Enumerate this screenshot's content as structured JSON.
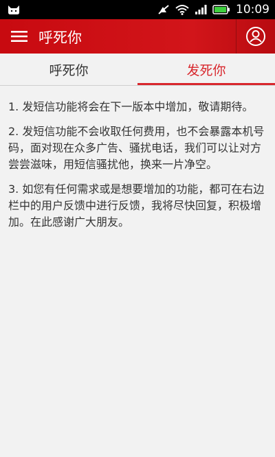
{
  "status_bar": {
    "time": "10:09",
    "icons": [
      "cat-icon",
      "mute-icon",
      "wifi-icon",
      "signal-icon",
      "battery-icon"
    ]
  },
  "app_bar": {
    "title": "呼死你",
    "menu_icon": "hamburger-icon",
    "user_icon": "user-circle-icon"
  },
  "tabs": [
    {
      "label": "呼死你",
      "selected": false
    },
    {
      "label": "发死你",
      "selected": true
    }
  ],
  "notice": [
    "1. 发短信功能将会在下一版本中增加，敬请期待。",
    "2. 发短信功能不会收取任何费用，也不会暴露本机号码，面对现在众多广告、骚扰电话，我们可以让对方尝尝滋味，用短信骚扰他，换来一片净空。",
    "3. 如您有任何需求或是想要增加的功能，都可在右边栏中的用户反馈中进行反馈，我将尽快回复，积极增加。在此感谢广大朋友。"
  ],
  "colors": {
    "accent": "#d8262c",
    "app_bar": "#c80a10",
    "background": "#f2f2f2"
  }
}
